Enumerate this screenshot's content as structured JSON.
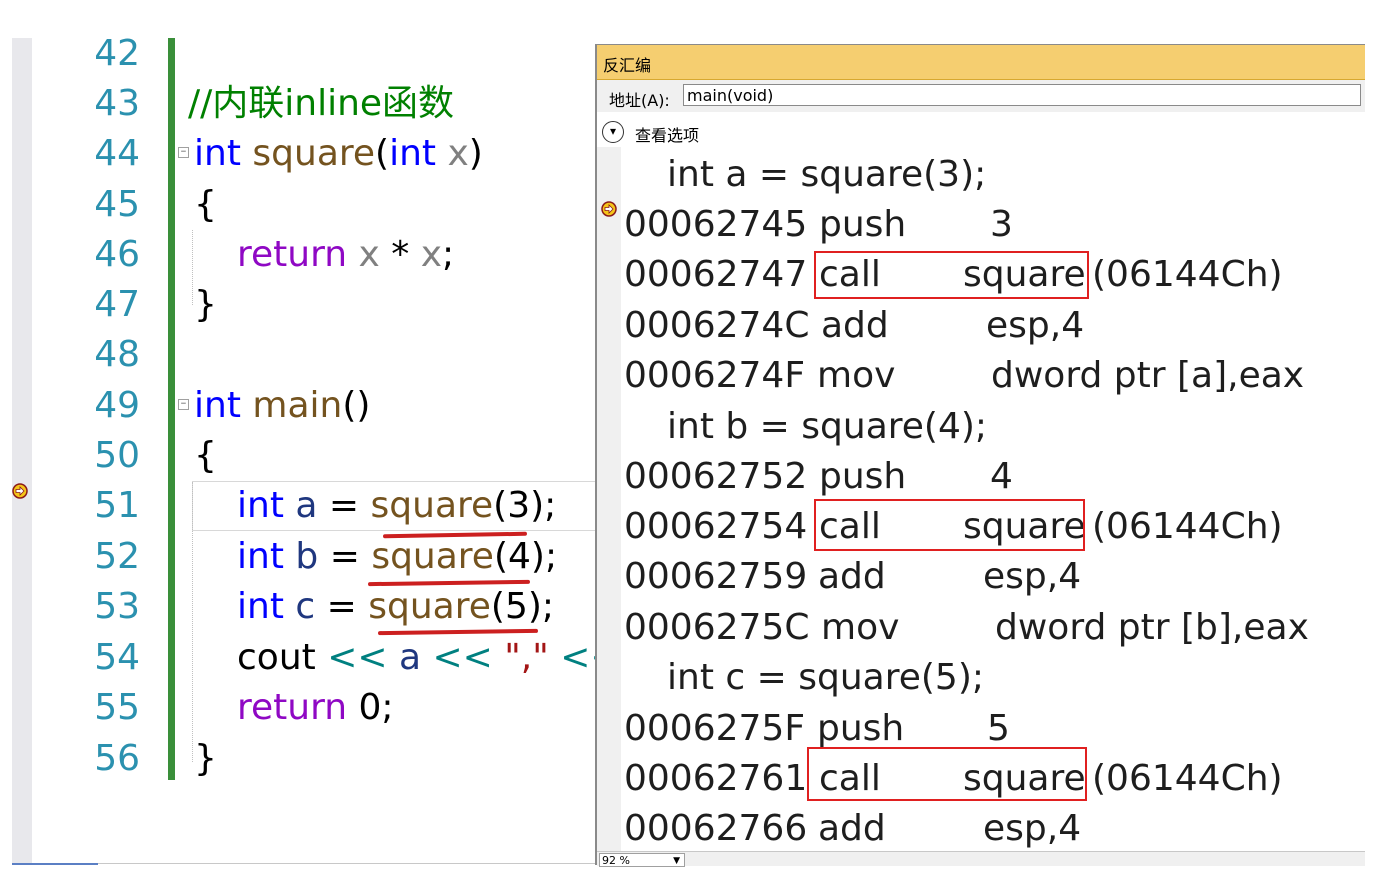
{
  "editor": {
    "lines": [
      {
        "num": "42"
      },
      {
        "num": "43"
      },
      {
        "num": "44"
      },
      {
        "num": "45"
      },
      {
        "num": "46"
      },
      {
        "num": "47"
      },
      {
        "num": "48"
      },
      {
        "num": "49"
      },
      {
        "num": "50"
      },
      {
        "num": "51"
      },
      {
        "num": "52"
      },
      {
        "num": "53"
      },
      {
        "num": "54"
      },
      {
        "num": "55"
      },
      {
        "num": "56"
      }
    ],
    "code": {
      "l43_comment": "//内联inline函数",
      "l44_int": "int",
      "l44_fn": "square",
      "l44_paren_open": "(",
      "l44_int2": "int",
      "l44_x": "x",
      "l44_paren_close": ")",
      "l45_brace": "{",
      "l46_return": "return",
      "l46_x1": "x",
      "l46_op": " * ",
      "l46_x2": "x",
      "l46_semi": ";",
      "l47_brace": "}",
      "l49_int": "int",
      "l49_main": "main",
      "l49_parens": "()",
      "l50_brace": "{",
      "l51_int": "int",
      "l51_a": "a",
      "l51_eq": " = ",
      "l51_fn": "square",
      "l51_arg": "(3);",
      "l52_int": "int",
      "l52_b": "b",
      "l52_eq": " = ",
      "l52_fn": "square",
      "l52_arg": "(4);",
      "l53_int": "int",
      "l53_c": "c",
      "l53_eq": " = ",
      "l53_fn": "square",
      "l53_arg": "(5);",
      "l54_cout": "cout",
      "l54_op1": " << ",
      "l54_a": "a",
      "l54_op2": " << ",
      "l54_str": "\",\"",
      "l54_op3": " <<",
      "l55_return": "return",
      "l55_val": " 0;",
      "l56_brace": "}"
    }
  },
  "disassembly": {
    "title": "反汇编",
    "address_label": "地址(A):",
    "address_value": "main(void)",
    "view_options_label": "查看选项",
    "zoom": "92 %",
    "rows": [
      {
        "source": "int a = square(3);"
      },
      {
        "addr": "00062745",
        "mnemonic": "push",
        "operand": "3"
      },
      {
        "addr": "00062747",
        "mnemonic": "call",
        "operand": "square",
        "extra": "(06144Ch)"
      },
      {
        "addr": "0006274C",
        "mnemonic": "add",
        "operand": "esp,4"
      },
      {
        "addr": "0006274F",
        "mnemonic": "mov",
        "operand": "dword ptr [a],eax"
      },
      {
        "source": "int b = square(4);"
      },
      {
        "addr": "00062752",
        "mnemonic": "push",
        "operand": "4"
      },
      {
        "addr": "00062754",
        "mnemonic": "call",
        "operand": "square",
        "extra": "(06144Ch)"
      },
      {
        "addr": "00062759",
        "mnemonic": "add",
        "operand": "esp,4"
      },
      {
        "addr": "0006275C",
        "mnemonic": "mov",
        "operand": "dword ptr [b],eax"
      },
      {
        "source": "int c = square(5);"
      },
      {
        "addr": "0006275F",
        "mnemonic": "push",
        "operand": "5"
      },
      {
        "addr": "00062761",
        "mnemonic": "call",
        "operand": "square",
        "extra": "(06144Ch)"
      },
      {
        "addr": "00062766",
        "mnemonic": "add",
        "operand": "esp,4"
      }
    ]
  },
  "colors": {
    "line_number": "#2b91af",
    "keyword": "#0000ff",
    "function": "#74531f",
    "comment": "#008000",
    "control": "#8f08c4",
    "title_bar": "#f5ce70",
    "highlight_box": "#e02020"
  }
}
